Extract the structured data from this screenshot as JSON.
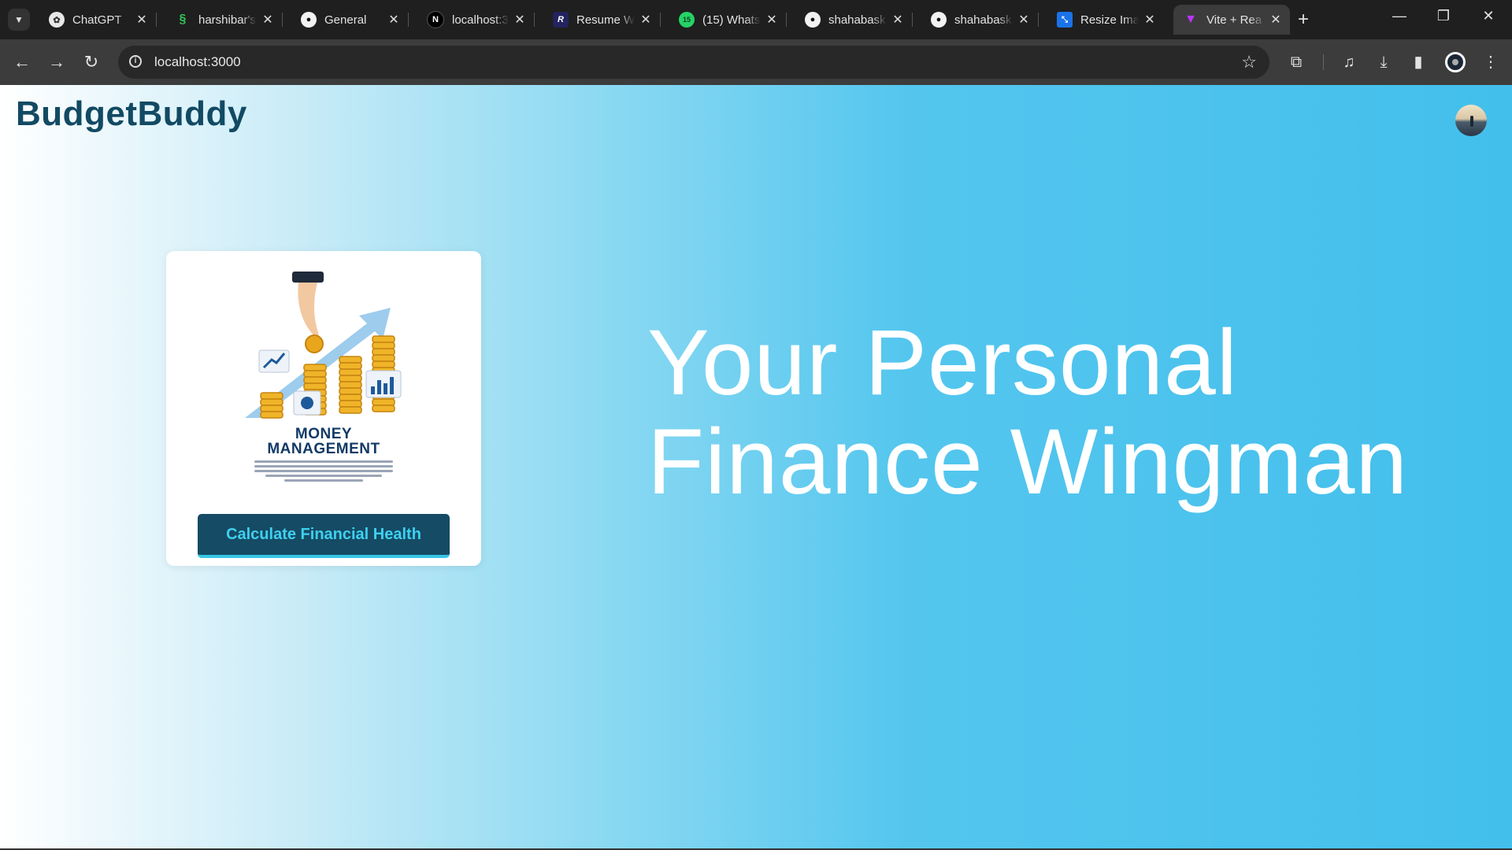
{
  "browser": {
    "tabs": [
      {
        "title": "ChatGPT",
        "icon": "chatgpt-icon"
      },
      {
        "title": "harshibar's",
        "icon": "leaf-icon"
      },
      {
        "title": "General",
        "icon": "github-icon"
      },
      {
        "title": "localhost:3",
        "icon": "next-icon"
      },
      {
        "title": "Resume W",
        "icon": "resume-icon"
      },
      {
        "title": "(15) Whats",
        "icon": "whatsapp-icon"
      },
      {
        "title": "shahabask",
        "icon": "github-icon"
      },
      {
        "title": "shahabask",
        "icon": "github-icon"
      },
      {
        "title": "Resize Ima",
        "icon": "resize-icon"
      },
      {
        "title": "Vite + Rea",
        "icon": "vite-icon",
        "active": true
      }
    ],
    "whatsapp_badge": "15",
    "address": "localhost:3000"
  },
  "app": {
    "brand": "BudgetBuddy",
    "card": {
      "illustration_line1": "MONEY",
      "illustration_line2": "MANAGEMENT",
      "button_label": "Calculate Financial Health"
    },
    "hero_line1": "Your Personal",
    "hero_line2": "Finance Wingman"
  },
  "colors": {
    "brand_text": "#124a63",
    "button_bg": "#154b64",
    "button_text": "#3fd0f0",
    "page_gradient_end": "#43bfec"
  }
}
